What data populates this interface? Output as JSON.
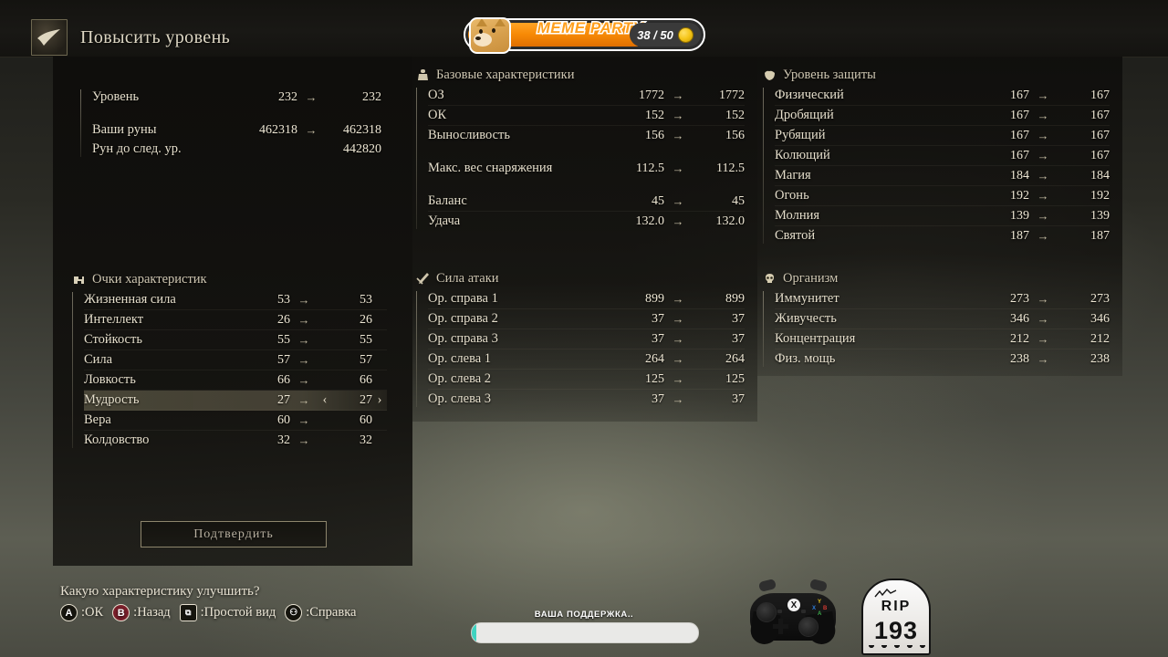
{
  "header": {
    "title": "Повысить уровень",
    "icon": "level-up-icon"
  },
  "meme_banner": {
    "label": "MEME PARTY",
    "count": "38 / 50",
    "coin_icon": "coin-icon",
    "doge_icon": "doge-icon",
    "progress_percent": 76
  },
  "summary": {
    "rows": [
      {
        "label": "Уровень",
        "current": "232",
        "arrow": "→",
        "next": "232"
      },
      {
        "label": "Ваши руны",
        "current": "462318",
        "arrow": "→",
        "next": "462318"
      },
      {
        "label": "Рун до след. ур.",
        "current": "",
        "arrow": "",
        "next": "442820"
      }
    ]
  },
  "attributes": {
    "icon": "muscle-icon",
    "title": "Очки характеристик",
    "rows": [
      {
        "label": "Жизненная сила",
        "current": "53",
        "arrow": "→",
        "next": "53",
        "selected": false
      },
      {
        "label": "Интеллект",
        "current": "26",
        "arrow": "→",
        "next": "26",
        "selected": false
      },
      {
        "label": "Стойкость",
        "current": "55",
        "arrow": "→",
        "next": "55",
        "selected": false
      },
      {
        "label": "Сила",
        "current": "57",
        "arrow": "→",
        "next": "57",
        "selected": false
      },
      {
        "label": "Ловкость",
        "current": "66",
        "arrow": "→",
        "next": "66",
        "selected": false
      },
      {
        "label": "Мудрость",
        "current": "27",
        "arrow": "→",
        "next": "27",
        "selected": true
      },
      {
        "label": "Вера",
        "current": "60",
        "arrow": "→",
        "next": "60",
        "selected": false
      },
      {
        "label": "Колдовство",
        "current": "32",
        "arrow": "→",
        "next": "32",
        "selected": false
      }
    ],
    "confirm_label": "Подтвердить"
  },
  "base_stats": {
    "icon": "statue-icon",
    "title": "Базовые характеристики",
    "rows": [
      {
        "label": "ОЗ",
        "current": "1772",
        "arrow": "→",
        "next": "1772"
      },
      {
        "label": "ОК",
        "current": "152",
        "arrow": "→",
        "next": "152"
      },
      {
        "label": "Выносливость",
        "current": "156",
        "arrow": "→",
        "next": "156"
      },
      {
        "label": "Макс. вес снаряжения",
        "current": "112.5",
        "arrow": "→",
        "next": "112.5"
      },
      {
        "label": "Баланс",
        "current": "45",
        "arrow": "→",
        "next": "45"
      },
      {
        "label": "Удача",
        "current": "132.0",
        "arrow": "→",
        "next": "132.0"
      }
    ]
  },
  "attack_power": {
    "icon": "sword-icon",
    "title": "Сила атаки",
    "rows": [
      {
        "label": "Ор. справа 1",
        "current": "899",
        "arrow": "→",
        "next": "899"
      },
      {
        "label": "Ор. справа 2",
        "current": "37",
        "arrow": "→",
        "next": "37"
      },
      {
        "label": "Ор. справа 3",
        "current": "37",
        "arrow": "→",
        "next": "37"
      },
      {
        "label": "Ор. слева 1",
        "current": "264",
        "arrow": "→",
        "next": "264"
      },
      {
        "label": "Ор. слева 2",
        "current": "125",
        "arrow": "→",
        "next": "125"
      },
      {
        "label": "Ор. слева 3",
        "current": "37",
        "arrow": "→",
        "next": "37"
      }
    ]
  },
  "defense": {
    "icon": "shield-icon",
    "title": "Уровень защиты",
    "rows": [
      {
        "label": "Физический",
        "current": "167",
        "arrow": "→",
        "next": "167"
      },
      {
        "label": "Дробящий",
        "current": "167",
        "arrow": "→",
        "next": "167"
      },
      {
        "label": "Рубящий",
        "current": "167",
        "arrow": "→",
        "next": "167"
      },
      {
        "label": "Колющий",
        "current": "167",
        "arrow": "→",
        "next": "167"
      },
      {
        "label": "Магия",
        "current": "184",
        "arrow": "→",
        "next": "184"
      },
      {
        "label": "Огонь",
        "current": "192",
        "arrow": "→",
        "next": "192"
      },
      {
        "label": "Молния",
        "current": "139",
        "arrow": "→",
        "next": "139"
      },
      {
        "label": "Святой",
        "current": "187",
        "arrow": "→",
        "next": "187"
      }
    ]
  },
  "resistance": {
    "icon": "skull-icon",
    "title": "Организм",
    "rows": [
      {
        "label": "Иммунитет",
        "current": "273",
        "arrow": "→",
        "next": "273"
      },
      {
        "label": "Живучесть",
        "current": "346",
        "arrow": "→",
        "next": "346"
      },
      {
        "label": "Концентрация",
        "current": "212",
        "arrow": "→",
        "next": "212"
      },
      {
        "label": "Физ. мощь",
        "current": "238",
        "arrow": "→",
        "next": "238"
      }
    ]
  },
  "footer": {
    "question": "Какую характеристику улучшить?",
    "hints": [
      {
        "glyph": "A",
        "label": ":ОК"
      },
      {
        "glyph": "B",
        "label": ":Назад"
      },
      {
        "glyph": "⧉",
        "label": ":Простой вид"
      },
      {
        "glyph": "⚇",
        "label": ":Справка"
      }
    ]
  },
  "support": {
    "title": "ВАША ПОДДЕРЖКА..",
    "progress_percent": 2
  },
  "gravestone": {
    "rip_text": "RIP",
    "death_count": "193"
  },
  "gamepad": {
    "name": "xbox-controller"
  },
  "colors": {
    "accent_orange": "#f78a06",
    "text_cream": "#e5decb",
    "highlight_row": "#78725a",
    "support_teal": "#3fd3c0"
  }
}
